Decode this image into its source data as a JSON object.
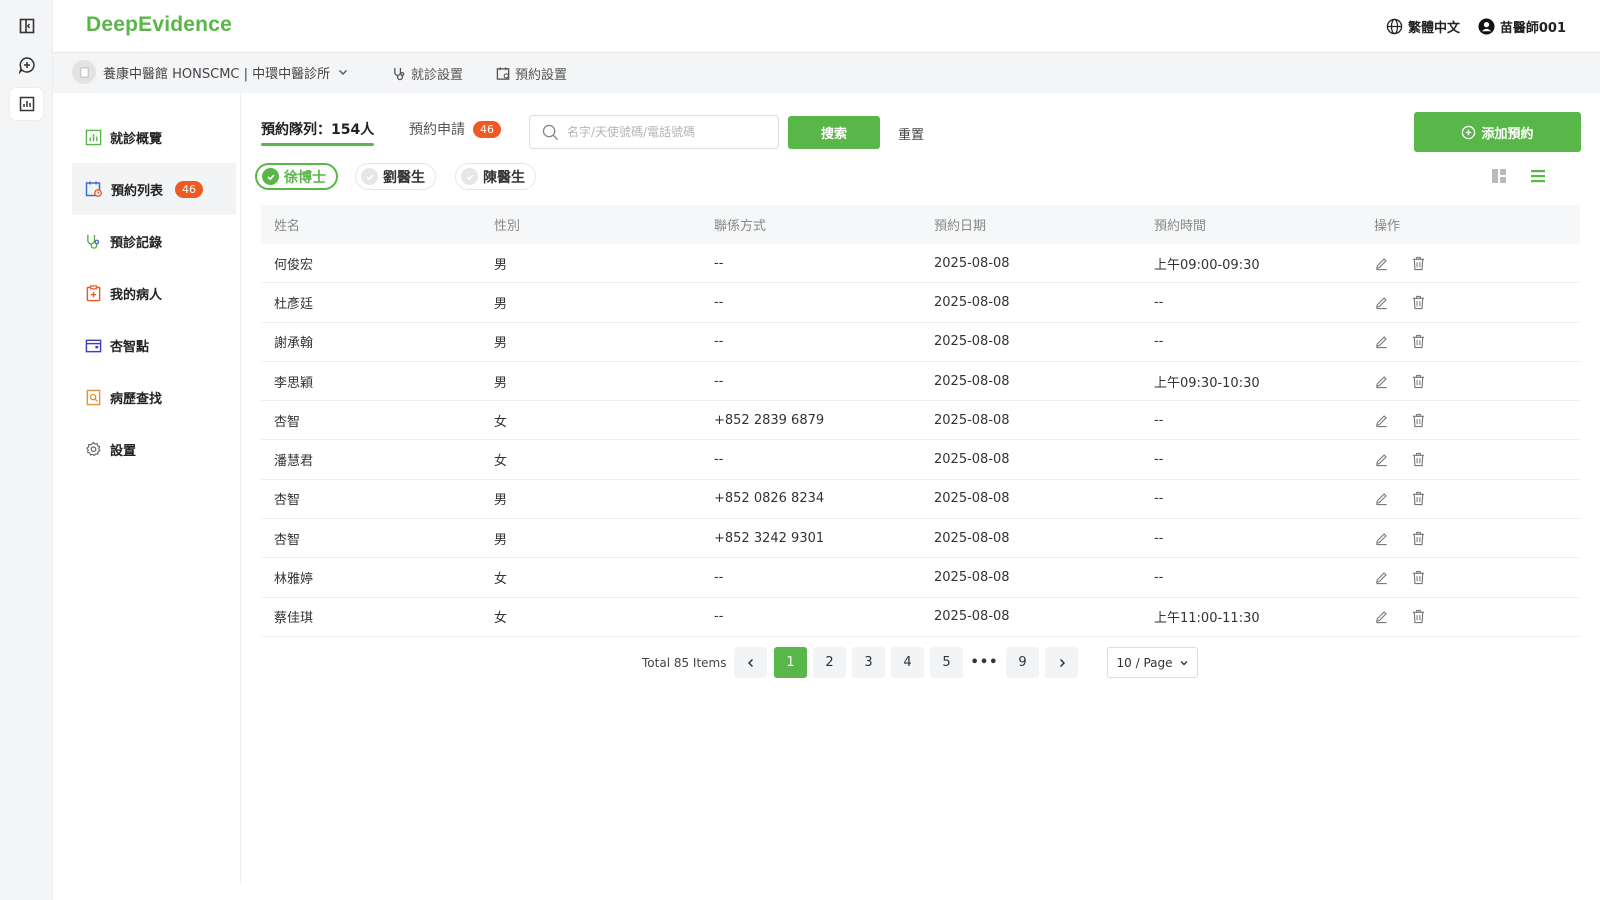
{
  "app": {
    "logo": "DeepEvidence",
    "language": "繁體中文",
    "user": "苗醫師001"
  },
  "rail": {
    "items": [
      "panel-toggle-icon",
      "new-chat-icon",
      "dashboard-icon"
    ]
  },
  "subbar": {
    "clinic": "養康中醫館 HONSCMC | 中環中醫診所",
    "visit_settings": "就診設置",
    "booking_settings": "預約設置"
  },
  "sidebar": {
    "items": [
      {
        "label": "就診概覽",
        "icon": "chart-icon"
      },
      {
        "label": "預約列表",
        "icon": "calendar-icon",
        "badge": "46"
      },
      {
        "label": "預診記錄",
        "icon": "stethoscope-icon"
      },
      {
        "label": "我的病人",
        "icon": "clipboard-icon"
      },
      {
        "label": "杏智點",
        "icon": "wallet-icon"
      },
      {
        "label": "病歷查找",
        "icon": "document-search-icon"
      },
      {
        "label": "設置",
        "icon": "gear-icon"
      }
    ]
  },
  "main": {
    "tab_queue": "預約隊列：154人",
    "tab_request": "預約申請",
    "tab_request_badge": "46",
    "search_placeholder": "名字/天使號碼/電話號碼",
    "search_label": "搜索",
    "reset_label": "重置",
    "add_label": "添加預約",
    "doctors": [
      "徐博士",
      "劉醫生",
      "陳醫生"
    ],
    "accent": "#59b649"
  },
  "table": {
    "headers": [
      "姓名",
      "性別",
      "聯係方式",
      "預約日期",
      "預約時間",
      "操作"
    ],
    "rows": [
      [
        "何俊宏",
        "男",
        "--",
        "2025-08-08",
        "上午09:00-09:30"
      ],
      [
        "杜彥廷",
        "男",
        "--",
        "2025-08-08",
        "--"
      ],
      [
        "謝承翰",
        "男",
        "--",
        "2025-08-08",
        "--"
      ],
      [
        "李思穎",
        "男",
        "--",
        "2025-08-08",
        "上午09:30-10:30"
      ],
      [
        "杏智",
        "女",
        "+852 2839 6879",
        "2025-08-08",
        "--"
      ],
      [
        "潘慧君",
        "女",
        "--",
        "2025-08-08",
        "--"
      ],
      [
        "杏智",
        "男",
        "+852 0826 8234",
        "2025-08-08",
        "--"
      ],
      [
        "杏智",
        "男",
        "+852 3242 9301",
        "2025-08-08",
        "--"
      ],
      [
        "林雅婷",
        "女",
        "--",
        "2025-08-08",
        "--"
      ],
      [
        "蔡佳琪",
        "女",
        "--",
        "2025-08-08",
        "上午11:00-11:30"
      ]
    ]
  },
  "pagination": {
    "total": "Total 85 Items",
    "pages": [
      "1",
      "2",
      "3",
      "4",
      "5",
      "•••",
      "9"
    ],
    "current": "1",
    "page_size": "10 / Page"
  }
}
